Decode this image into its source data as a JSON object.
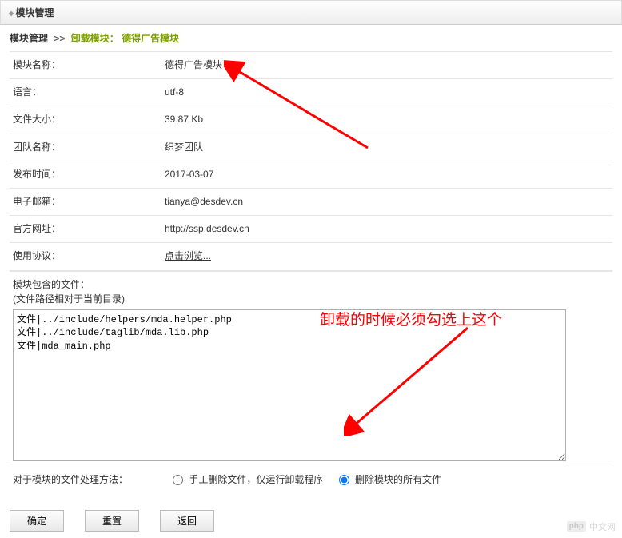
{
  "header": {
    "title": "模块管理"
  },
  "breadcrumb": {
    "root": "模块管理",
    "sep": ">>",
    "page": "卸载模块：",
    "module": "德得广告模块"
  },
  "info": {
    "name_label": "模块名称：",
    "name_value": "德得广告模块",
    "lang_label": "语言：",
    "lang_value": "utf-8",
    "size_label": "文件大小：",
    "size_value": "39.87 Kb",
    "team_label": "团队名称：",
    "team_value": "织梦团队",
    "date_label": "发布时间：",
    "date_value": "2017-03-07",
    "email_label": "电子邮箱：",
    "email_value": "tianya@desdev.cn",
    "url_label": "官方网址：",
    "url_value": "http://ssp.desdev.cn",
    "license_label": "使用协议：",
    "license_value": "点击浏览..."
  },
  "files": {
    "label_line1": "模块包含的文件：",
    "label_line2": "(文件路径相对于当前目录)",
    "content": "文件|../include/helpers/mda.helper.php\n文件|../include/taglib/mda.lib.php\n文件|mda_main.php"
  },
  "radio": {
    "label": "对于模块的文件处理方法：",
    "opt1": "手工删除文件，仅运行卸载程序",
    "opt2": "删除模块的所有文件"
  },
  "buttons": {
    "ok": "确定",
    "reset": "重置",
    "back": "返回"
  },
  "annotation": {
    "text": "卸载的时候必须勾选上这个"
  },
  "watermark": {
    "badge": "php",
    "text": "中文网"
  }
}
